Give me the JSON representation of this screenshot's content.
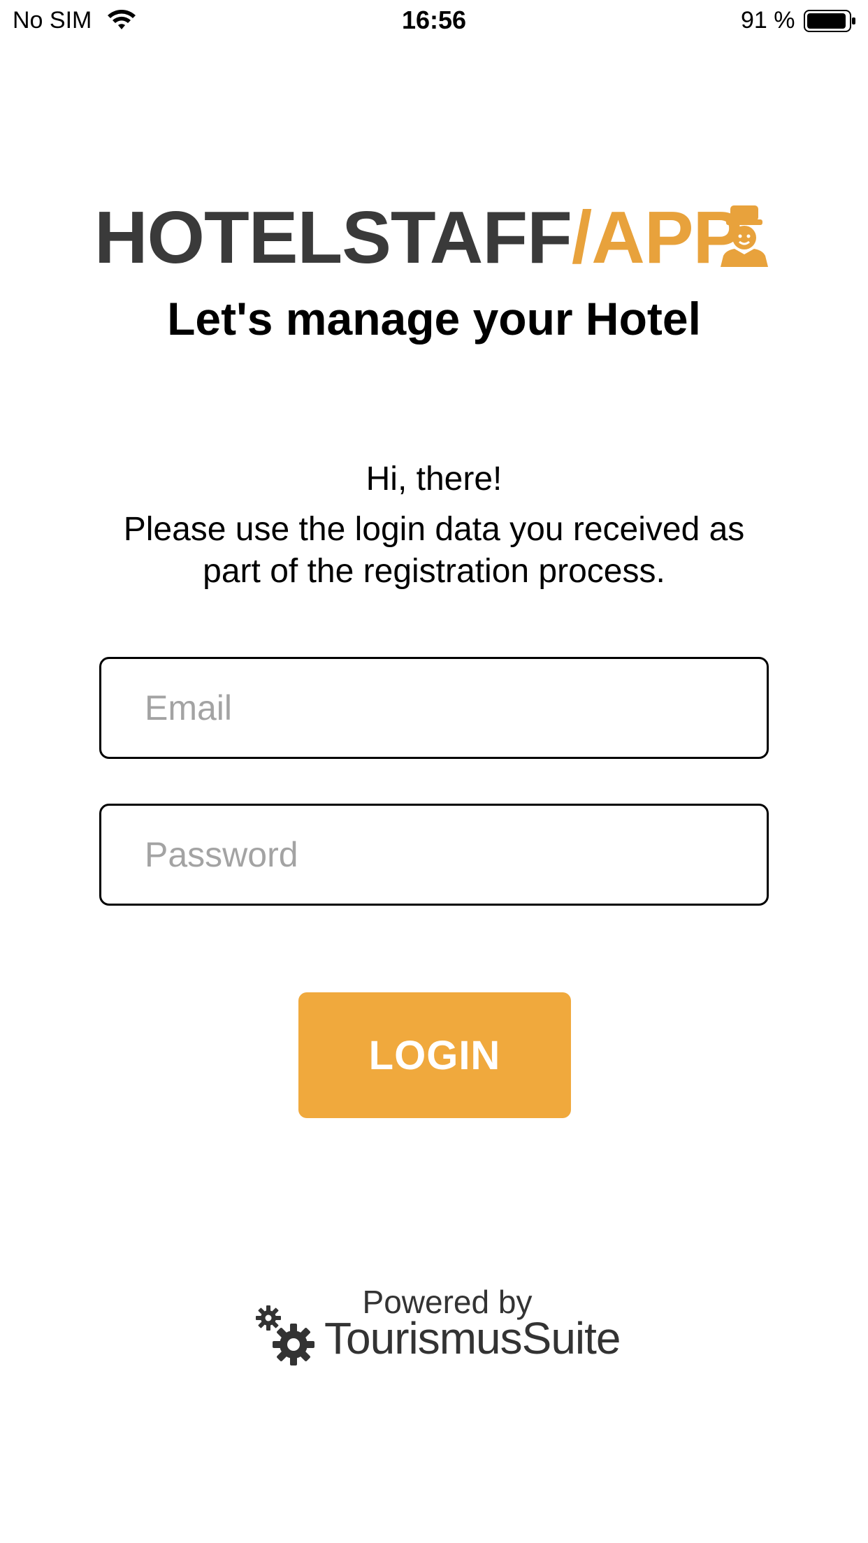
{
  "status_bar": {
    "carrier": "No SIM",
    "time": "16:56",
    "battery_text": "91 %",
    "icons": [
      "wifi-icon",
      "battery-icon"
    ]
  },
  "logo": {
    "part1": "HOTELSTAFF",
    "part2": "/APP",
    "icon": "bellboy-icon",
    "colors": {
      "dark": "#3a3a3a",
      "accent": "#e8a23c"
    }
  },
  "tagline": "Let's manage your Hotel",
  "greeting": "Hi, there!",
  "instructions": "Please use the login data you received as part of the registration process.",
  "form": {
    "email_placeholder": "Email",
    "email_value": "",
    "password_placeholder": "Password",
    "password_value": "",
    "login_label": "LOGIN",
    "button_color": "#f0a93d"
  },
  "footer": {
    "powered_by": "Powered by",
    "brand": "TourismusSuite",
    "icon": "gears-icon"
  }
}
